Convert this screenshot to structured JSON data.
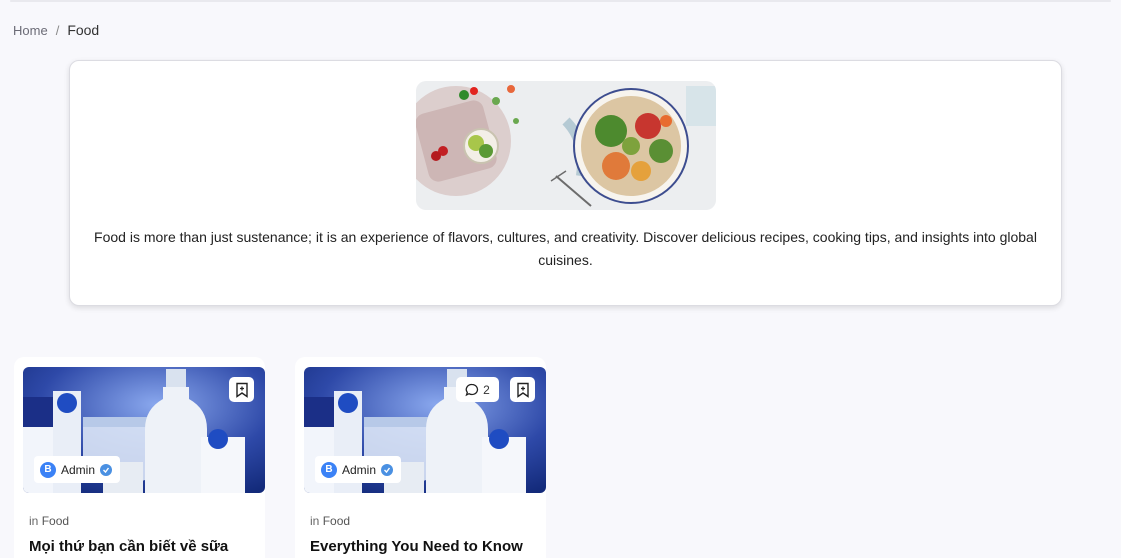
{
  "breadcrumb": {
    "home": "Home",
    "separator": "/",
    "current": "Food"
  },
  "hero": {
    "image_alt": "salad bowl with vegetables",
    "description": "Food is more than just sustenance; it is an experience of flavors, cultures, and creativity. Discover delicious recipes, cooking tips, and insights into global cuisines."
  },
  "cards": [
    {
      "category_prefix": "in",
      "category": "Food",
      "title": "Mọi thứ bạn cần biết về sữa",
      "author": "Admin",
      "author_initial": "B",
      "comments": "",
      "icon_bookmark": "bookmark-icon"
    },
    {
      "category_prefix": "in",
      "category": "Food",
      "title": "Everything You Need to Know",
      "author": "Admin",
      "author_initial": "B",
      "comments": "2",
      "icon_bookmark": "bookmark-icon"
    }
  ],
  "colors": {
    "accent": "#3b82f6",
    "page_bg": "#f8f8fc",
    "milk_bg": "#2e49a8"
  }
}
